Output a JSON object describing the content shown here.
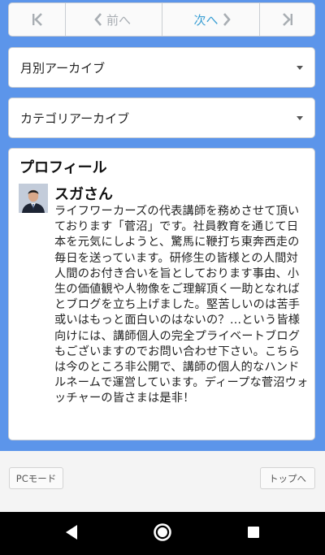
{
  "pager": {
    "first_icon": "first-page-icon",
    "prev_label": "前へ",
    "next_label": "次へ",
    "last_icon": "last-page-icon"
  },
  "archives": {
    "monthly_label": "月別アーカイブ",
    "category_label": "カテゴリアーカイブ"
  },
  "profile": {
    "heading": "プロフィール",
    "name": "スガさん",
    "bio": "ライフワーカーズの代表講師を務めさせて頂いております「菅沼」です。社員教育を通じて日本を元気にしようと、驚馬に鞭打ち東奔西走の毎日を送っています。研修生の皆様との人間対人間のお付き合いを旨としております事由、小生の価値観や人物像をご理解頂く一助となればとブログを立ち上げました。堅苦しいのは苦手或いはもっと面白いのはないの？…という皆様向けには、講師個人の完全プライベートブログもございますのでお問い合わせ下さい。こちらは今のところ非公開で、講師の個人的なハンドルネームで運営しています。ディープな菅沼ウォッチャーの皆さまは是非！"
  },
  "footer": {
    "pc_mode": "PCモード",
    "to_top": "トップへ"
  },
  "colors": {
    "background": "#5c95ea",
    "accent": "#3b9fd4"
  }
}
